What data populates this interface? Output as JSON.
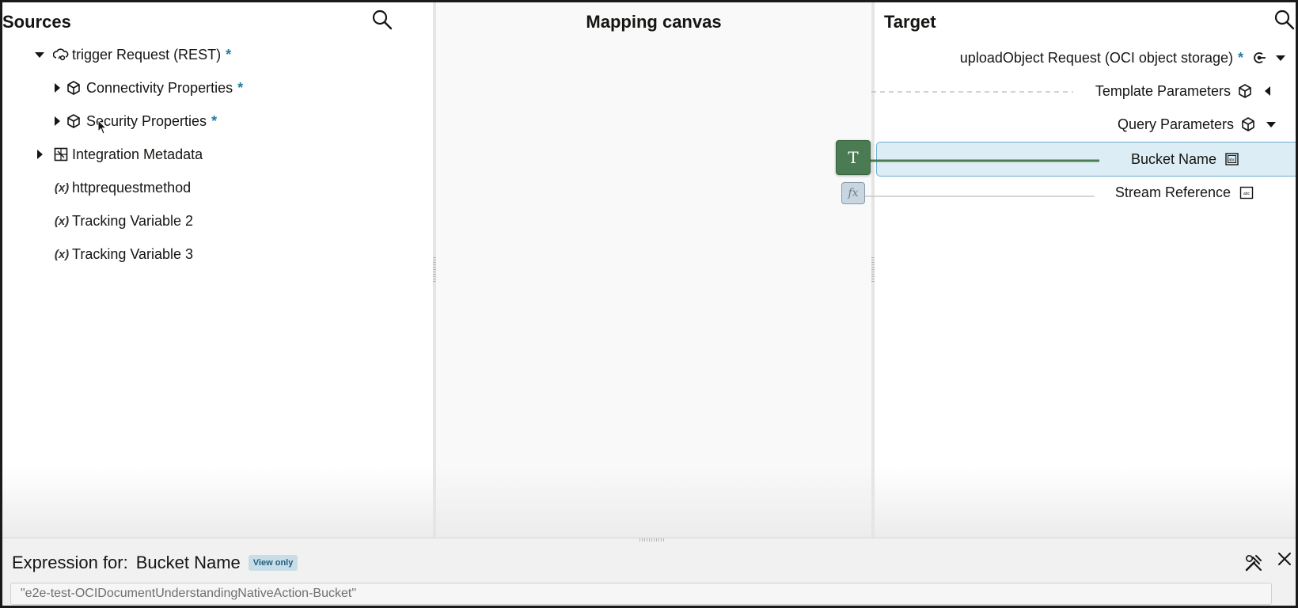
{
  "sources": {
    "title": "Sources",
    "items": [
      {
        "label": "trigger Request (REST)",
        "required": "*",
        "expanded": true
      },
      {
        "label": "Connectivity Properties",
        "required": "*"
      },
      {
        "label": "Security Properties",
        "required": "*"
      },
      {
        "label": "Integration Metadata"
      },
      {
        "label": "httprequestmethod"
      },
      {
        "label": "Tracking Variable 2"
      },
      {
        "label": "Tracking Variable 3"
      }
    ],
    "variable_marker": "(x)"
  },
  "canvas": {
    "title": "Mapping canvas",
    "nodes": {
      "text_node": "T",
      "function_node": "fx"
    }
  },
  "target": {
    "title": "Target",
    "items": [
      {
        "label": "uploadObject Request (OCI object storage)",
        "required": "*"
      },
      {
        "label": "Template Parameters"
      },
      {
        "label": "Query Parameters"
      },
      {
        "label": "Bucket Name",
        "selected": true
      },
      {
        "label": "Stream Reference"
      }
    ]
  },
  "expression": {
    "prefix": "Expression for:",
    "field": "Bucket Name",
    "badge": "View only",
    "value": "\"e2e-test-OCIDocumentUnderstandingNativeAction-Bucket\""
  },
  "colors": {
    "accent": "#227e9e",
    "selected_row": "#dcedf5",
    "text_node": "#4b7b52",
    "mapping_line": "#4b7b52"
  }
}
